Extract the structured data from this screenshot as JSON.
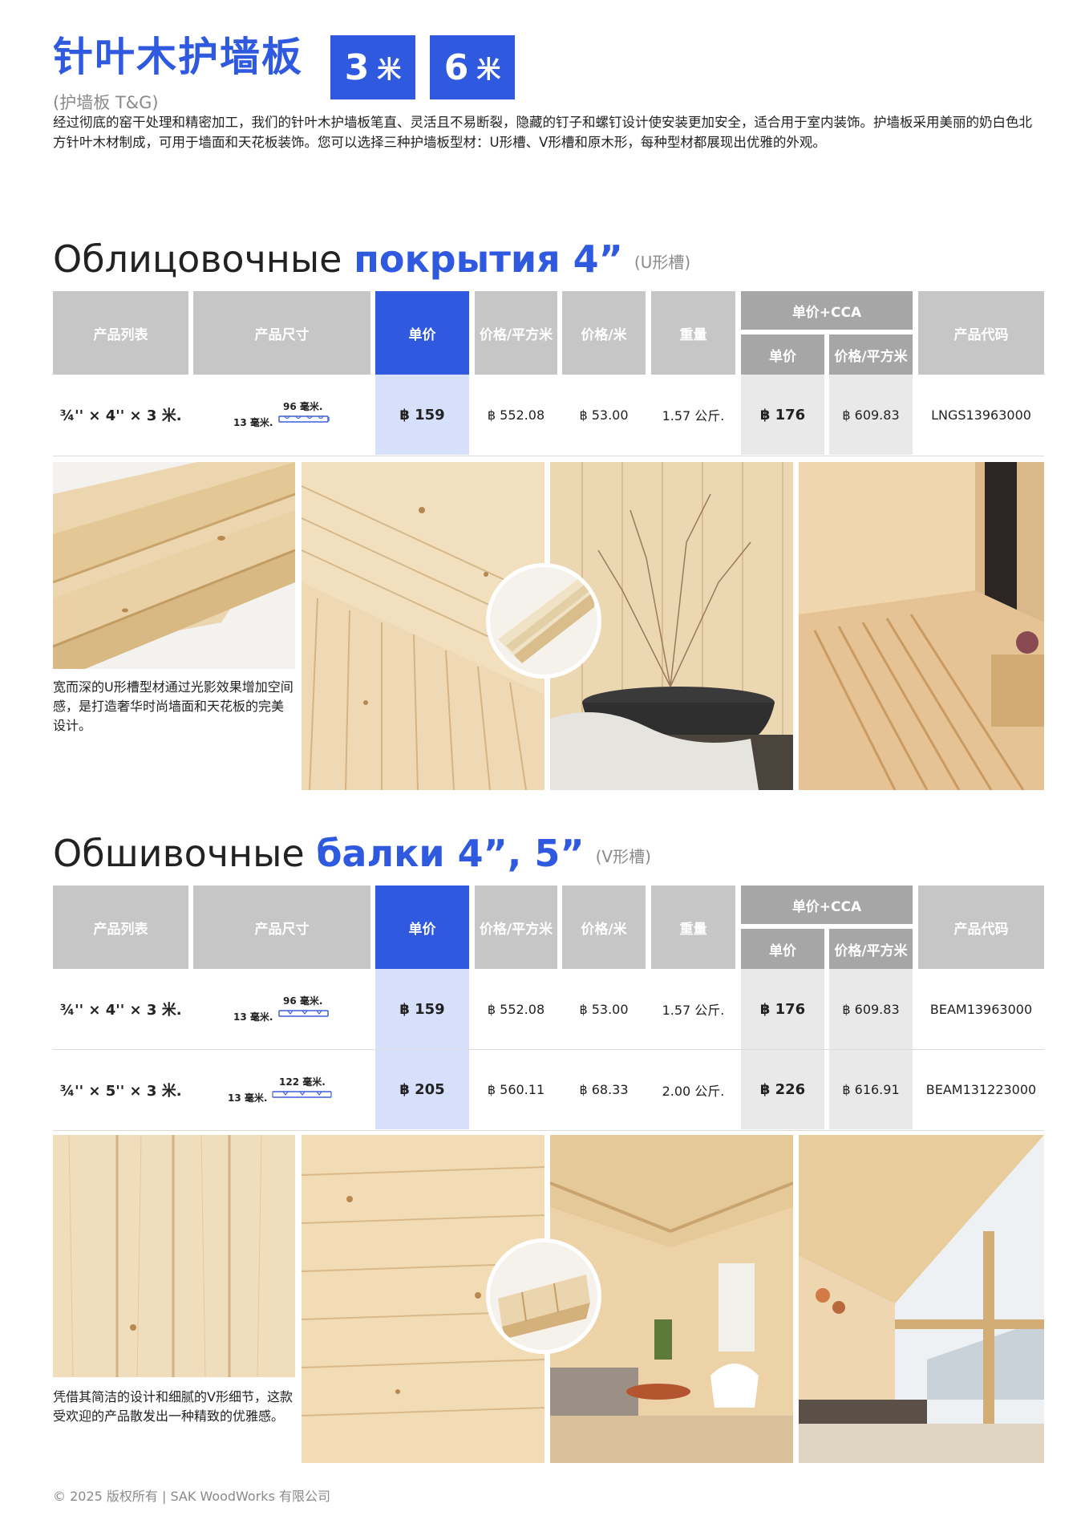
{
  "header": {
    "title": "针叶木护墙板",
    "badges": [
      {
        "num": "3",
        "unit": "米"
      },
      {
        "num": "6",
        "unit": "米"
      }
    ],
    "subtitle": "(护墙板 T&G)",
    "intro": "经过彻底的窑干处理和精密加工，我们的针叶木护墙板笔直、灵活且不易断裂，隐藏的钉子和螺钉设计使安装更加安全，适合用于室内装饰。护墙板采用美丽的奶白色北方针叶木材制成，可用于墙面和天花板装饰。您可以选择三种护墙板型材：U形槽、V形槽和原木形，每种型材都展现出优雅的外观。"
  },
  "columns": {
    "product": "产品列表",
    "size": "产品尺寸",
    "unit_price": "单价",
    "price_sqm": "价格/平方米",
    "price_m": "价格/米",
    "weight": "重量",
    "cca_group": "单价+CCA",
    "cca_unit": "单价",
    "cca_sqm": "价格/平方米",
    "code": "产品代码"
  },
  "section1": {
    "title_plain": "Облицовочные ",
    "title_bold": "покрытия 4”",
    "note": "(U形槽)",
    "rows": [
      {
        "product": "¾'' × 4'' × 3 米.",
        "width": "96 毫米.",
        "thickness": "13 毫米.",
        "unit_price": "฿ 159",
        "price_sqm": "฿ 552.08",
        "price_m": "฿ 53.00",
        "weight": "1.57 公斤.",
        "cca_unit": "฿ 176",
        "cca_sqm": "฿ 609.83",
        "code": "LNGS13963000"
      }
    ],
    "caption": "宽而深的U形槽型材通过光影效果增加空间感，是打造奢华时尚墙面和天花板的完美设计。"
  },
  "section2": {
    "title_plain": "Обшивочные ",
    "title_bold": "балки 4”, 5”",
    "note": "(V形槽)",
    "rows": [
      {
        "product": "¾'' × 4'' × 3 米.",
        "width": "96 毫米.",
        "thickness": "13 毫米.",
        "unit_price": "฿ 159",
        "price_sqm": "฿ 552.08",
        "price_m": "฿ 53.00",
        "weight": "1.57 公斤.",
        "cca_unit": "฿ 176",
        "cca_sqm": "฿ 609.83",
        "code": "BEAM13963000"
      },
      {
        "product": "¾'' × 5'' × 3 米.",
        "width": "122 毫米.",
        "thickness": "13 毫米.",
        "unit_price": "฿ 205",
        "price_sqm": "฿ 560.11",
        "price_m": "฿ 68.33",
        "weight": "2.00 公斤.",
        "cca_unit": "฿ 226",
        "cca_sqm": "฿ 616.91",
        "code": "BEAM131223000"
      }
    ],
    "caption": "凭借其简洁的设计和细腻的V形细节，这款受欢迎的产品散发出一种精致的优雅感。"
  },
  "footer": "© 2025 版权所有 | SAK WoodWorks 有限公司",
  "colors": {
    "accent": "#2f5ae0",
    "header_gray": "#c6c6c6",
    "cca_gray": "#a6a6a6",
    "highlight_blue": "#d6e0fb",
    "highlight_gray": "#e9e9e9"
  }
}
